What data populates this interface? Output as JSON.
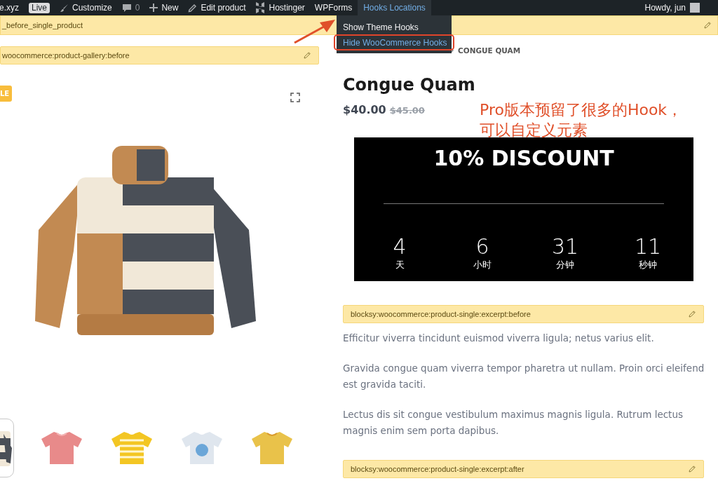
{
  "admin_bar": {
    "items": [
      {
        "kind": "site",
        "label": "e.xyz"
      },
      {
        "kind": "badge",
        "label": "Live"
      },
      {
        "kind": "customize",
        "label": "Customize"
      },
      {
        "kind": "comments",
        "label": "0"
      },
      {
        "kind": "new",
        "label": "New"
      },
      {
        "kind": "edit",
        "label": "Edit product"
      },
      {
        "kind": "hostinger",
        "label": "Hostinger"
      },
      {
        "kind": "text",
        "label": "WPForms"
      },
      {
        "kind": "menu",
        "label": "Hooks Locations",
        "expanded": true,
        "menu": [
          {
            "label": "Show Theme Hooks",
            "selected": false
          },
          {
            "label": "Hide WooCommerce Hooks",
            "selected": true
          }
        ]
      }
    ],
    "greeting": "Howdy, jun"
  },
  "top_hook": "_before_single_product",
  "gallery": {
    "hook": "woocommerce:product-gallery:before",
    "sale_badge": "LE",
    "thumbnails": [
      {
        "selected": true
      },
      {
        "selected": false
      },
      {
        "selected": false
      },
      {
        "selected": false
      },
      {
        "selected": false
      }
    ]
  },
  "product": {
    "breadcrumb": "CONGUE QUAM",
    "title": "Congue Quam",
    "price": "$40.00",
    "old_price": "$45.00",
    "countdown": {
      "title": "10% DISCOUNT",
      "units": [
        {
          "value": "4",
          "label": "天"
        },
        {
          "value": "6",
          "label": "小时"
        },
        {
          "value": "31",
          "label": "分钟"
        },
        {
          "value": "11",
          "label": "秒钟"
        }
      ]
    },
    "hook_before": "blocksy:woocommerce:product-single:excerpt:before",
    "paragraphs": [
      [
        "Efficitur viverra tincidunt euismod viverra ligula; netus varius elit."
      ],
      [
        "Gravida congue quam viverra tempor pharetra ut nullam. Proin orci eleifend",
        "est gravida taciti."
      ],
      [
        "Lectus dis sit congue vestibulum maximus magnis ligula. Rutrum lectus",
        "magnis enim sem porta dapibus."
      ]
    ],
    "hook_after": "blocksy:woocommerce:product-single:excerpt:after"
  },
  "annotation": {
    "lines": [
      "Pro版本预留了很多的Hook，",
      "可以自定义元素"
    ]
  }
}
